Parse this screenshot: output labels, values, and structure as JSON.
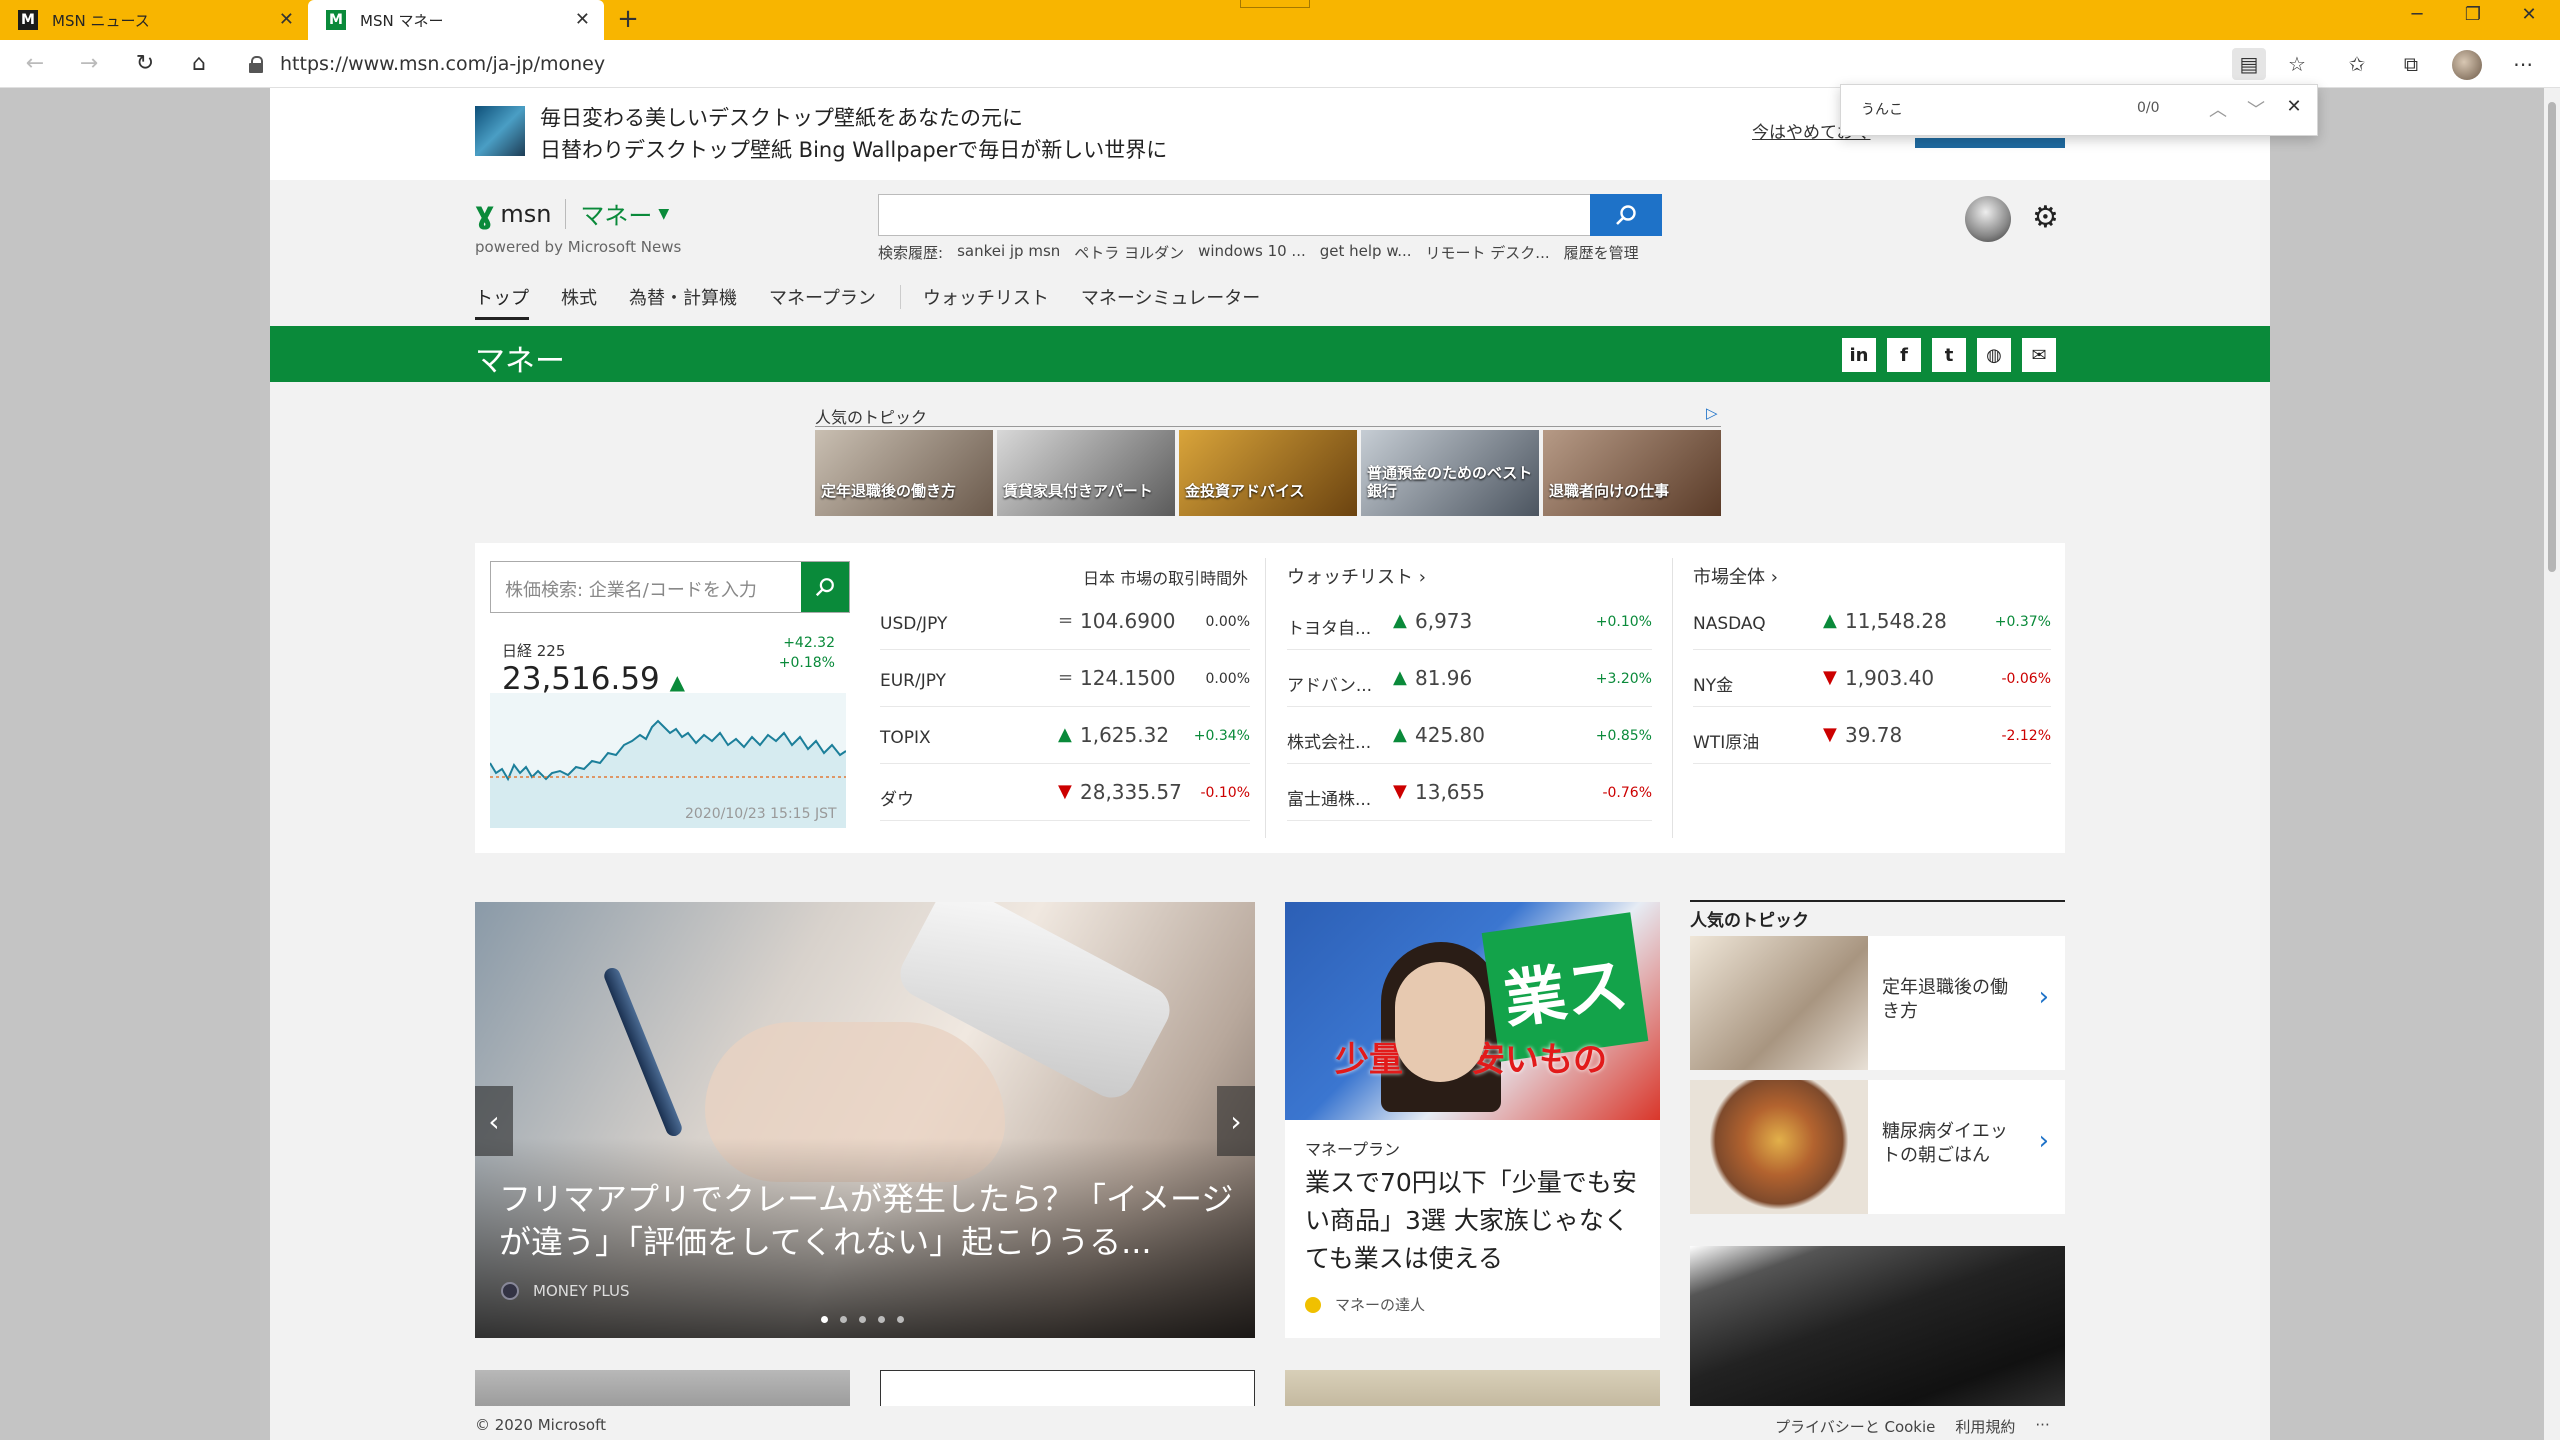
{
  "browser": {
    "tabs": [
      {
        "title": "MSN ニュース",
        "favicon": "M"
      },
      {
        "title": "MSN マネー",
        "favicon": "M"
      }
    ],
    "url": "https://www.msn.com/ja-jp/money",
    "find": {
      "query": "うんこ",
      "count": "0/0"
    }
  },
  "banner": {
    "line1": "毎日変わる美しいデスクトップ壁紙をあなたの元に",
    "line2": "日替わりデスクトップ壁紙 Bing Wallpaperで毎日が新しい世界に",
    "later": "今はやめておく"
  },
  "header": {
    "logo": "msn",
    "section": "マネー",
    "powered": "powered by Microsoft News",
    "history_label": "検索履歴:",
    "history": [
      "sankei jp msn",
      "ペトラ ヨルダン",
      "windows 10 ...",
      "get help w...",
      "リモート デスク..."
    ],
    "manage_history": "履歴を管理"
  },
  "nav": {
    "items": [
      "トップ",
      "株式",
      "為替・計算機",
      "マネープラン"
    ],
    "items2": [
      "ウォッチリスト",
      "マネーシミュレーター"
    ]
  },
  "section_title": "マネー",
  "ad": {
    "title": "人気のトピック",
    "tiles": [
      "定年退職後の働き方",
      "賃貸家具付きアパート",
      "金投資アドバイス",
      "普通預金のためのベスト銀行",
      "退職者向けの仕事"
    ]
  },
  "market": {
    "search_placeholder": "株価検索: 企業名/コードを入力",
    "nikkei": {
      "name": "日経 225",
      "value": "23,516.59",
      "change": "+42.32",
      "pct": "+0.18%",
      "date": "2020/10/23 15:15 JST"
    },
    "status": "日本 市場の取引時間外",
    "fx": [
      {
        "name": "USD/JPY",
        "dir": "eq",
        "value": "104.6900",
        "pct": "0.00%"
      },
      {
        "name": "EUR/JPY",
        "dir": "eq",
        "value": "124.1500",
        "pct": "0.00%"
      },
      {
        "name": "TOPIX",
        "dir": "up",
        "value": "1,625.32",
        "pct": "+0.34%"
      },
      {
        "name": "ダウ",
        "dir": "dn",
        "value": "28,335.57",
        "pct": "-0.10%"
      }
    ],
    "watchlist_title": "ウォッチリスト",
    "watchlist": [
      {
        "name": "トヨタ自...",
        "dir": "up",
        "value": "6,973",
        "pct": "+0.10%"
      },
      {
        "name": "アドバン...",
        "dir": "up",
        "value": "81.96",
        "pct": "+3.20%"
      },
      {
        "name": "株式会社...",
        "dir": "up",
        "value": "425.80",
        "pct": "+0.85%"
      },
      {
        "name": "富士通株...",
        "dir": "dn",
        "value": "13,655",
        "pct": "-0.76%"
      }
    ],
    "overall_title": "市場全体",
    "overall": [
      {
        "name": "NASDAQ",
        "dir": "up",
        "value": "11,548.28",
        "pct": "+0.37%"
      },
      {
        "name": "NY金",
        "dir": "dn",
        "value": "1,903.40",
        "pct": "-0.06%"
      },
      {
        "name": "WTI原油",
        "dir": "dn",
        "value": "39.78",
        "pct": "-2.12%"
      }
    ]
  },
  "hero": {
    "title": "フリマアプリでクレームが発生したら？「イメージが違う」「評価をしてくれない」起こりうる...",
    "source": "MONEY PLUS"
  },
  "card2": {
    "category": "マネープラン",
    "title": "業スで70円以下「少量でも安い商品」3選 大家族じゃなくても業スは使える",
    "source": "マネーの達人",
    "img_text1": "業ス",
    "img_text2": "少量でも安いもの"
  },
  "side": {
    "title": "人気のトピック",
    "items": [
      "定年退職後の働き方",
      "糖尿病ダイエットの朝ごはん"
    ]
  },
  "footer": {
    "copyright": "© 2020 Microsoft",
    "privacy": "プライバシーと Cookie",
    "terms": "利用規約",
    "more": "···"
  },
  "colors": {
    "brand_green": "#0a8a3a",
    "tab_yellow": "#f8b500",
    "search_blue": "#1e72c8",
    "up": "#0a8a3a",
    "down": "#cc0000"
  }
}
